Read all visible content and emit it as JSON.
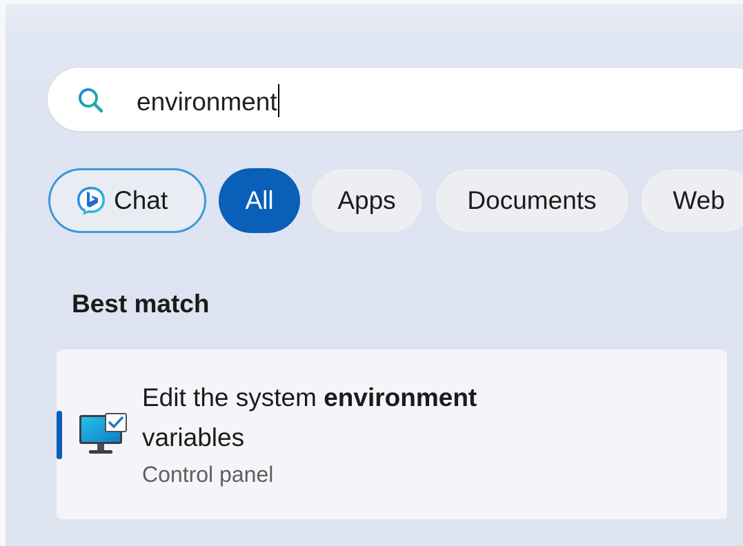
{
  "search": {
    "value": "environment",
    "icon": "search-icon"
  },
  "filters": {
    "chat": "Chat",
    "all": "All",
    "apps": "Apps",
    "documents": "Documents",
    "web": "Web",
    "active": "All"
  },
  "section": {
    "heading": "Best match"
  },
  "best_match": {
    "title_prefix": "Edit the system ",
    "title_highlight": "environment",
    "title_suffix": "variables",
    "subtitle": "Control panel",
    "icon": "system-properties-icon"
  },
  "colors": {
    "accent": "#0a5fb8",
    "chat_border": "#3a97d8"
  }
}
